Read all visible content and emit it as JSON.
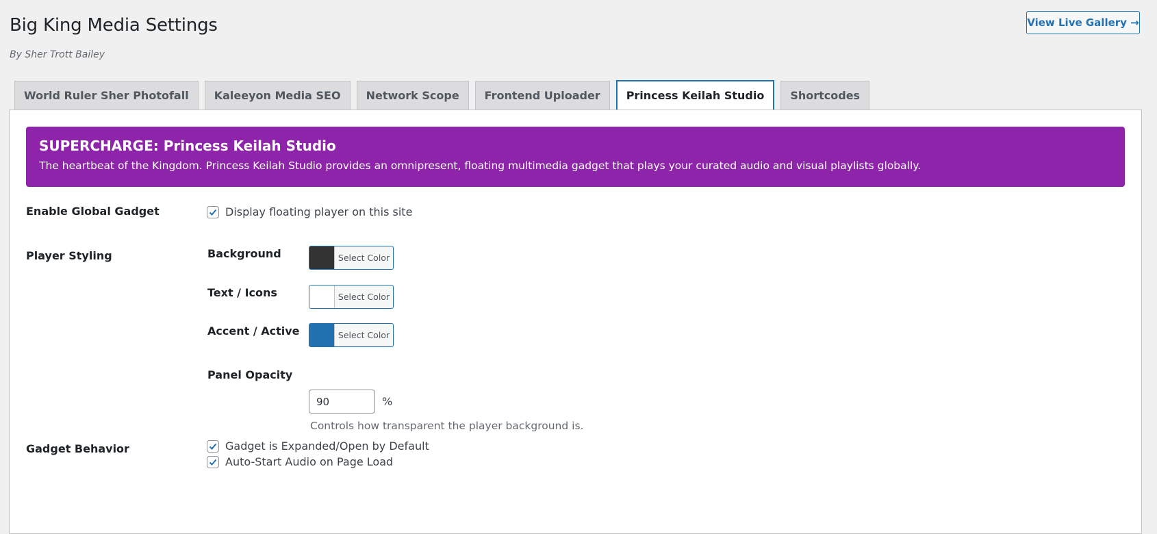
{
  "header": {
    "title": "Big King Media Settings",
    "byline": "By Sher Trott Bailey",
    "live_button": "View Live Gallery →"
  },
  "tabs": [
    {
      "label": "World Ruler Sher Photofall",
      "active": false
    },
    {
      "label": "Kaleeyon Media SEO",
      "active": false
    },
    {
      "label": "Network Scope",
      "active": false
    },
    {
      "label": "Frontend Uploader",
      "active": false
    },
    {
      "label": "Princess Keilah Studio",
      "active": true
    },
    {
      "label": "Shortcodes",
      "active": false
    }
  ],
  "banner": {
    "title": "SUPERCHARGE: Princess Keilah Studio",
    "description": "The heartbeat of the Kingdom. Princess Keilah Studio provides an omnipresent, floating multimedia gadget that plays your curated audio and visual playlists globally.",
    "color": "#8e24aa"
  },
  "settings": {
    "enable_gadget": {
      "label": "Enable Global Gadget",
      "checkbox_label": "Display floating player on this site",
      "checked": true
    },
    "styling": {
      "label": "Player Styling",
      "background": {
        "label": "Background",
        "button": "Select Color",
        "color": "#333333"
      },
      "text_icons": {
        "label": "Text / Icons",
        "button": "Select Color",
        "color": "#ffffff"
      },
      "accent": {
        "label": "Accent / Active",
        "button": "Select Color",
        "color": "#2271b1"
      },
      "opacity": {
        "label": "Panel Opacity",
        "value": "90",
        "unit": "%",
        "help": "Controls how transparent the player background is."
      }
    },
    "behavior": {
      "label": "Gadget Behavior",
      "expanded": {
        "label": "Gadget is Expanded/Open by Default",
        "checked": true
      },
      "autostart": {
        "label": "Auto-Start Audio on Page Load",
        "checked": true
      }
    }
  }
}
